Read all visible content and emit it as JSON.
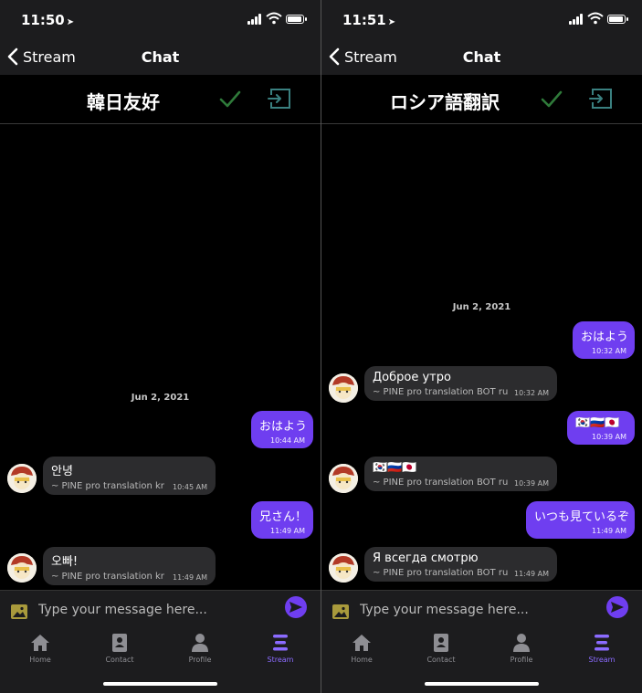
{
  "colors": {
    "accent": "#6f3ef0",
    "bar_bg": "#1c1c1e",
    "incoming_bubble": "#2c2c2e",
    "check": "#2f7a3a",
    "exit": "#3a8080"
  },
  "screens": [
    {
      "status_time": "11:50",
      "nav": {
        "back_label": "Stream",
        "title": "Chat"
      },
      "room_name": "韓日友好",
      "date": "Jun 2, 2021",
      "messages": [
        {
          "dir": "out",
          "text": "おはよう",
          "time": "10:44 AM"
        },
        {
          "dir": "in",
          "text": "안녕",
          "sender": "~ PINE pro translation kr",
          "time": "10:45 AM"
        },
        {
          "dir": "out",
          "text": "兄さん！",
          "time": "11:49 AM"
        },
        {
          "dir": "in",
          "text": "오빠!",
          "sender": "~ PINE pro translation kr",
          "time": "11:49 AM"
        }
      ],
      "input_placeholder": "Type your message here...",
      "tabs": [
        {
          "label": "Home",
          "icon": "home-icon"
        },
        {
          "label": "Contact",
          "icon": "contact-icon"
        },
        {
          "label": "Profile",
          "icon": "profile-icon"
        },
        {
          "label": "Stream",
          "icon": "stream-icon",
          "active": true
        }
      ]
    },
    {
      "status_time": "11:51",
      "nav": {
        "back_label": "Stream",
        "title": "Chat"
      },
      "room_name": "ロシア語翻訳",
      "date": "Jun 2, 2021",
      "messages": [
        {
          "dir": "out",
          "text": "おはよう",
          "time": "10:32 AM"
        },
        {
          "dir": "in",
          "text": "Доброе утро",
          "sender": "~ PINE pro translation BOT ru",
          "time": "10:32 AM"
        },
        {
          "dir": "out",
          "text": "🇰🇷🇷🇺🇯🇵",
          "icons": [
            "flag-kr-icon",
            "flag-ru-icon",
            "flag-jp-icon"
          ],
          "time": "10:39 AM"
        },
        {
          "dir": "in",
          "text": "🇰🇷🇷🇺🇯🇵",
          "icons": [
            "flag-kr-icon",
            "flag-ru-icon",
            "flag-jp-icon"
          ],
          "sender": "~ PINE pro translation BOT ru",
          "time": "10:39 AM"
        },
        {
          "dir": "out",
          "text": "いつも見ているぞ",
          "time": "11:49 AM"
        },
        {
          "dir": "in",
          "text": "Я всегда смотрю",
          "sender": "~ PINE pro translation BOT ru",
          "time": "11:49 AM"
        }
      ],
      "input_placeholder": "Type your message here...",
      "tabs": [
        {
          "label": "Home",
          "icon": "home-icon"
        },
        {
          "label": "Contact",
          "icon": "contact-icon"
        },
        {
          "label": "Profile",
          "icon": "profile-icon"
        },
        {
          "label": "Stream",
          "icon": "stream-icon",
          "active": true
        }
      ]
    }
  ]
}
